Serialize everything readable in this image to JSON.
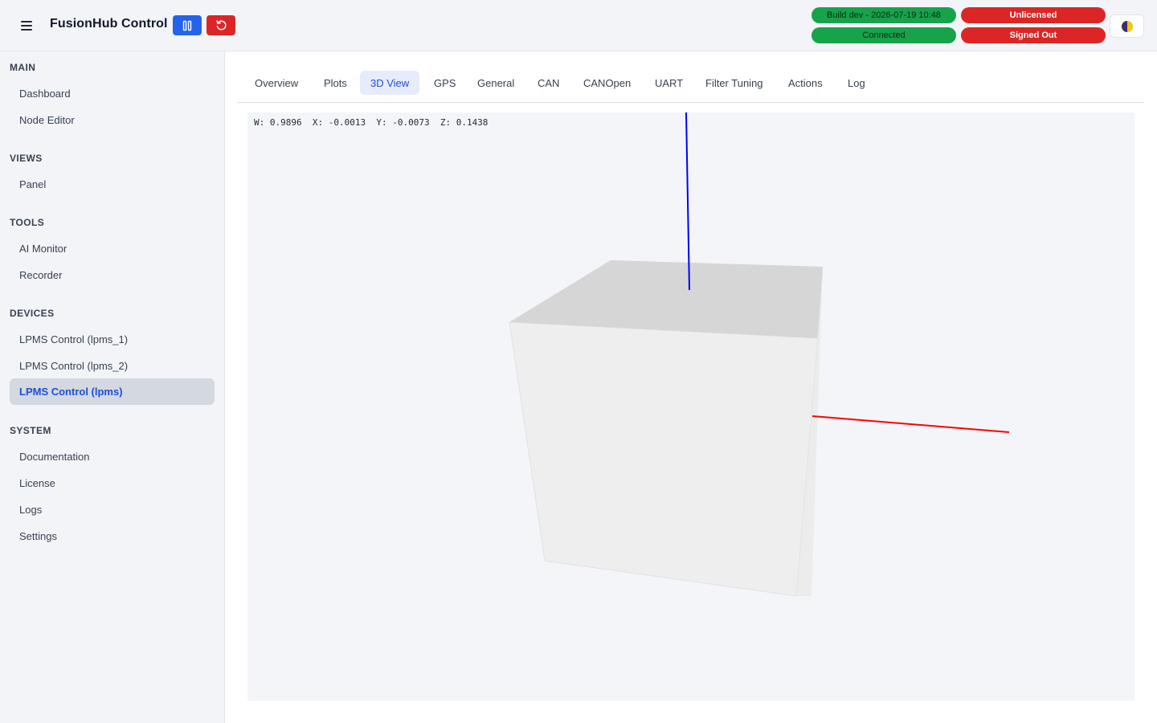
{
  "header": {
    "title": "FusionHub Control",
    "badges": {
      "build": "Build dev - 2026-07-19 10:48",
      "connection": "Connected",
      "license": "Unlicensed",
      "account": "Signed Out"
    }
  },
  "colors": {
    "primary": "#2563eb",
    "danger": "#dc2626",
    "success": "#16a34a",
    "axis_x": "#ff0000",
    "axis_z": "#0000ff"
  },
  "icons": {
    "menu": "hamburger-icon",
    "pause": "pause-icon",
    "restart": "restart-icon",
    "theme": "half-moon-icon"
  },
  "sidebar": {
    "sections": {
      "main": "MAIN",
      "views": "VIEWS",
      "tools": "TOOLS",
      "devices": "DEVICES",
      "system": "SYSTEM"
    },
    "items": {
      "dashboard": "Dashboard",
      "node_editor": "Node Editor",
      "panel": "Panel",
      "ai_monitor": "AI Monitor",
      "recorder": "Recorder",
      "lpms_1": "LPMS Control (lpms_1)",
      "lpms_2": "LPMS Control (lpms_2)",
      "lpms": "LPMS Control (lpms)",
      "documentation": "Documentation",
      "license": "License",
      "logs": "Logs",
      "settings": "Settings"
    },
    "active_item": "LPMS Control (lpms)"
  },
  "tabs": {
    "overview": "Overview",
    "plots": "Plots",
    "view3d": "3D View",
    "gps": "GPS",
    "general": "General",
    "can": "CAN",
    "canopen": "CANOpen",
    "uart": "UART",
    "filter_tuning": "Filter Tuning",
    "actions": "Actions",
    "log": "Log",
    "active": "3D View"
  },
  "view3d": {
    "quaternion": {
      "w": "W: 0.9896",
      "x": "X: -0.0013",
      "y": "Y: -0.0073",
      "z": "Z: 0.1438"
    }
  }
}
